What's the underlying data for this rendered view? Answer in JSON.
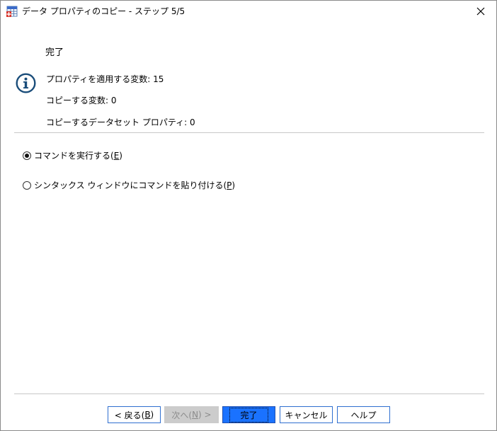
{
  "window": {
    "title": "データ プロパティのコピー - ステップ 5/5"
  },
  "content": {
    "heading": "完了",
    "summary": [
      "プロパティを適用する変数: 15",
      "コピーする変数: 0",
      "コピーするデータセット プロパティ: 0"
    ]
  },
  "options": {
    "run_command_label": "コマンドを実行する(",
    "run_command_key": "E",
    "paste_syntax_label": "シンタックス ウィンドウにコマンドを貼り付ける(",
    "paste_syntax_key": "P",
    "close_paren": ")",
    "selected": "run_command"
  },
  "buttons": {
    "back_label": "< 戻る(",
    "back_key": "B",
    "next_label": "次へ(",
    "next_key": "N",
    "next_suffix": ") >",
    "finish_label": "完了",
    "cancel_label": "キャンセル",
    "help_label": "ヘルプ",
    "close_paren": ")"
  },
  "colors": {
    "primary_button": "#1a72ff",
    "button_border": "#2f6fd0",
    "info_icon": "#1a4d7a",
    "disabled_button": "#cccccc"
  }
}
